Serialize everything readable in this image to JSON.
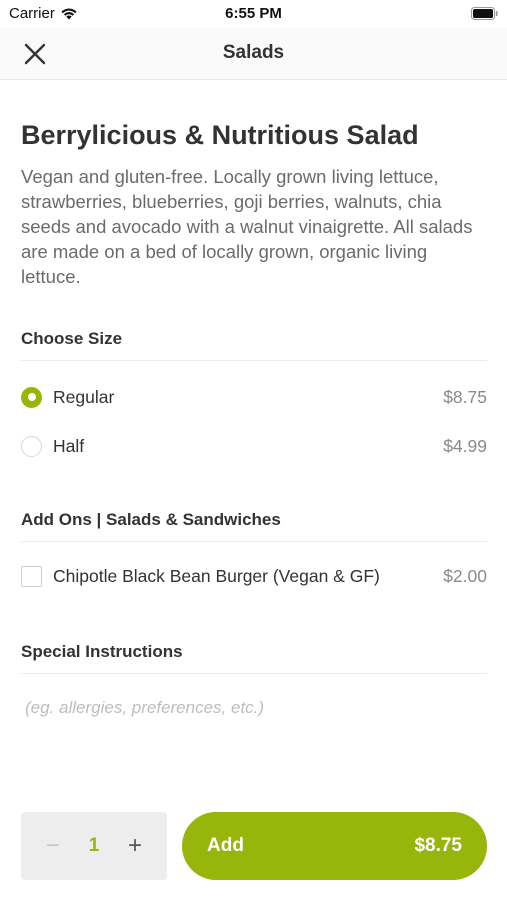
{
  "status_bar": {
    "carrier": "Carrier",
    "time": "6:55 PM"
  },
  "nav": {
    "title": "Salads",
    "close_icon": "close-icon"
  },
  "item": {
    "title": "Berrylicious & Nutritious Salad",
    "description": "Vegan and gluten-free. Locally grown living lettuce, strawberries, blueberries, goji berries, walnuts, chia seeds and avocado with a walnut vinaigrette. All salads are made on a bed of locally grown, organic living lettuce."
  },
  "size_section": {
    "heading": "Choose Size",
    "options": [
      {
        "label": "Regular",
        "price": "$8.75",
        "selected": true
      },
      {
        "label": "Half",
        "price": "$4.99",
        "selected": false
      }
    ]
  },
  "addons_section": {
    "heading": "Add Ons | Salads & Sandwiches",
    "options": [
      {
        "label": "Chipotle Black Bean Burger (Vegan & GF)",
        "price": "$2.00",
        "checked": false
      }
    ]
  },
  "instructions": {
    "heading": "Special Instructions",
    "placeholder": "(eg. allergies, preferences, etc.)",
    "value": ""
  },
  "order": {
    "quantity": "1",
    "minus_symbol": "−",
    "plus_symbol": "+",
    "add_label": "Add",
    "add_price": "$8.75"
  },
  "colors": {
    "accent": "#98b50c",
    "stepper_bg": "#ededed",
    "muted_text": "#8a8a8a"
  }
}
